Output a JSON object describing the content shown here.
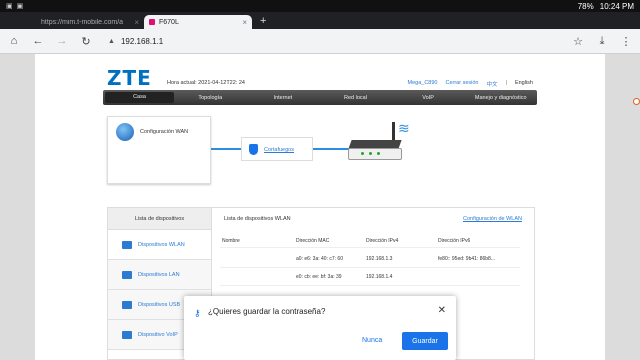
{
  "status_bar": {
    "time": "10:24 PM",
    "battery": "78%"
  },
  "tabs": [
    {
      "title": "https://mim.t-mobile.com/a",
      "close": "×"
    },
    {
      "title": "F670L",
      "close": "×"
    }
  ],
  "new_tab": "+",
  "address_bar": {
    "url": "192.168.1.1"
  },
  "header": {
    "logo": "ZTE",
    "current_time": "Hora actual: 2021-04-12T22: 24",
    "user": "Mega_C890",
    "logout": "Cerrar sesión",
    "lang_cn": "中文",
    "lang_sep": "|",
    "lang_en": "English"
  },
  "nav": [
    "Casa",
    "Topología",
    "Internet",
    "Red local",
    "VoIP",
    "Manejo y diagnóstico"
  ],
  "topology": {
    "wan_label": "Configuración WAN",
    "firewall_link": "Cortafuegos"
  },
  "devices": {
    "title": "Lista de dispositivos",
    "items": [
      "Dispositivos WLAN",
      "Dispositivos LAN",
      "Dispositivos USB",
      "Dispositivo VoIP"
    ],
    "wlan_title": "Lista de dispositivos WLAN",
    "wlan_config": "Configuración de WLAN",
    "columns": [
      "Nombre",
      "Dirección MAC",
      "Dirección IPv4",
      "Dirección IPv6"
    ],
    "rows": [
      [
        "",
        "a0: e6: 3a: 40: c7: 60",
        "192.168.1.3",
        "fe80:: 95ed: 9b41: 86b8..."
      ],
      [
        "",
        "e0: cb: ee: bf: 3a: 39",
        "192.168.1.4",
        ""
      ]
    ]
  },
  "password_dialog": {
    "title": "¿Quieres guardar la contraseña?",
    "cancel": "Nunca",
    "save": "Guardar",
    "close": "✕"
  },
  "colors": {
    "accent": "#1a73e8",
    "nav_bg": "#333333",
    "link": "#2b7bd3"
  }
}
